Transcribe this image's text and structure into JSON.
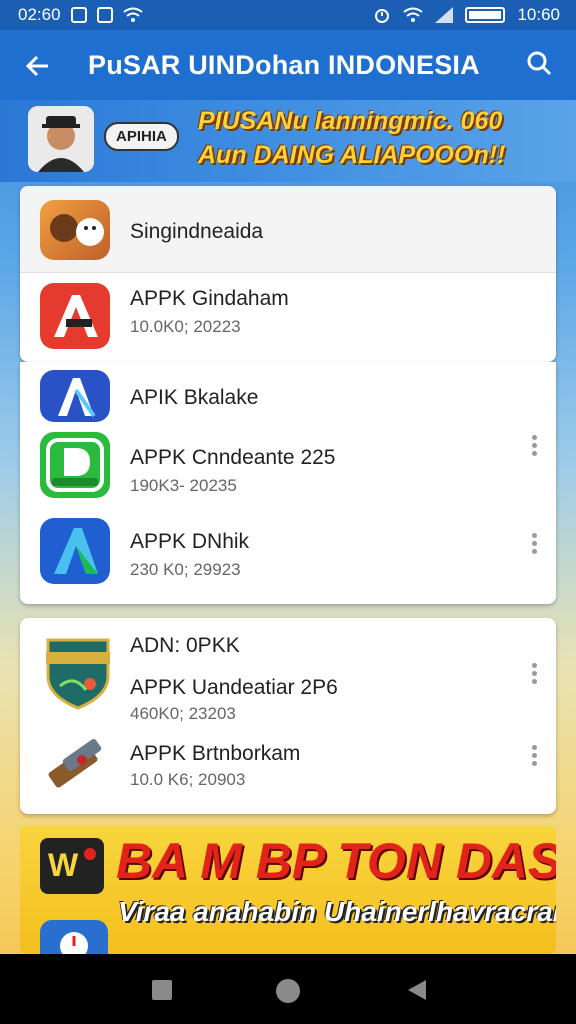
{
  "status": {
    "time_left": "02:60",
    "time_right": "10:60"
  },
  "header": {
    "title": "PuSAR UINDohan INDONESIA"
  },
  "banner": {
    "badge": "APIHIA",
    "promo_line1": "PIUSANu lanningmic. 060",
    "promo_line2": "Aun DAING ALIAPOOOn!!"
  },
  "card1": {
    "items": [
      {
        "name": "Singindneaida",
        "meta": ""
      },
      {
        "name": "APPK Gindaham",
        "meta": "10.0K0; 20223"
      }
    ]
  },
  "card2": {
    "items": [
      {
        "name": "APIK Bkalake",
        "meta": ""
      },
      {
        "name": "APPK Cnndeante 225",
        "meta": "190K3- 20235"
      },
      {
        "name": "APPK DNhik",
        "meta": "230 K0; 29923"
      }
    ]
  },
  "card3": {
    "items": [
      {
        "name": "ADN: 0PKK",
        "meta": ""
      },
      {
        "name": "APPK Uandeatiar 2P6",
        "meta": "460K0; 23203"
      },
      {
        "name": "APPK Brtnborkam",
        "meta": "10.0 K6; 20903"
      }
    ]
  },
  "bottom_banner": {
    "title": "BA M BP TON DASi!/",
    "subtitle": "Viraa anahabin Uhainerlhavracran!"
  },
  "colors": {
    "appbar": "#1f6fd0",
    "accent_red": "#e2231a",
    "accent_yellow": "#f8d53d"
  }
}
